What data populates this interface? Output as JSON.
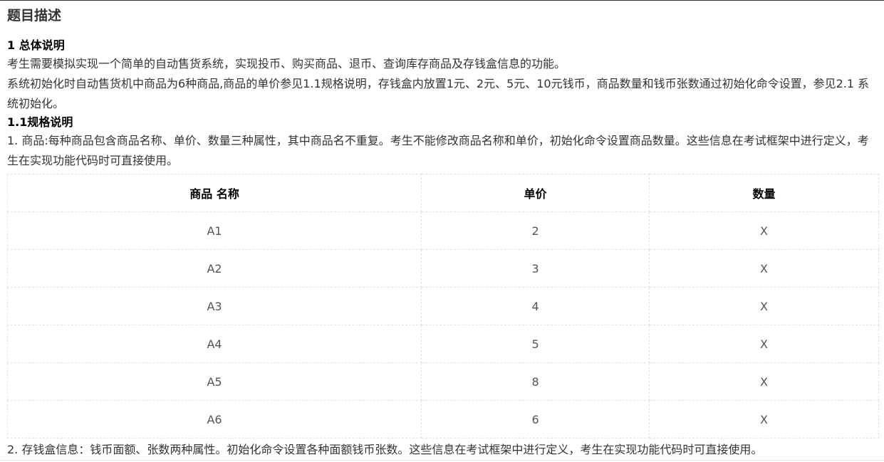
{
  "page": {
    "title": "题目描述"
  },
  "section1": {
    "heading": "1 总体说明",
    "para1": "考生需要模拟实现一个简单的自动售货系统，实现投币、购买商品、退币、查询库存商品及存钱盒信息的功能。",
    "para2": "系统初始化时自动售货机中商品为6种商品,商品的单价参见1.1规格说明，存钱盒内放置1元、2元、5元、10元钱币，商品数量和钱币张数通过初始化命令设置，参见2.1 系统初始化。"
  },
  "section11": {
    "heading": "1.1规格说明",
    "item1": "1. 商品:每种商品包含商品名称、单价、数量三种属性，其中商品名不重复。考生不能修改商品名称和单价，初始化命令设置商品数量。这些信息在考试框架中进行定义，考生在实现功能代码时可直接使用。",
    "item2": "2. 存钱盒信息：钱币面额、张数两种属性。初始化命令设置各种面额钱币张数。这些信息在考试框架中进行定义，考生在实现功能代码时可直接使用。"
  },
  "table": {
    "headers": [
      "商品 名称",
      "单价",
      "数量"
    ],
    "rows": [
      [
        "A1",
        "2",
        "X"
      ],
      [
        "A2",
        "3",
        "X"
      ],
      [
        "A3",
        "4",
        "X"
      ],
      [
        "A4",
        "5",
        "X"
      ],
      [
        "A5",
        "8",
        "X"
      ],
      [
        "A6",
        "6",
        "X"
      ]
    ]
  }
}
